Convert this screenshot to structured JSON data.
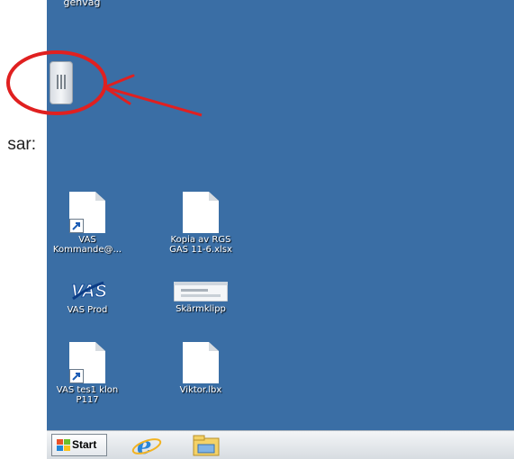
{
  "left_text": "sar:",
  "desktop": {
    "top_caption": "genväg",
    "icons": [
      {
        "label_line1": "VAS",
        "label_line2": "Kommande@...",
        "icon": "document-shortcut-icon"
      },
      {
        "label_line1": "Kopia av RGS",
        "label_line2": "GAS 11-6.xlsx",
        "icon": "document-icon"
      },
      {
        "label_line1": "VAS Prod",
        "label_line2": "",
        "icon": "vas-logo-icon"
      },
      {
        "label_line1": "Skärmklipp",
        "label_line2": "",
        "icon": "screenshot-thumbnail-icon"
      },
      {
        "label_line1": "VAS tes1 klon",
        "label_line2": "P117",
        "icon": "document-shortcut-icon"
      },
      {
        "label_line1": "Viktor.lbx",
        "label_line2": "",
        "icon": "document-icon"
      }
    ]
  },
  "taskbar": {
    "start_label": "Start",
    "pinned": [
      "internet-explorer-icon",
      "file-explorer-icon"
    ]
  },
  "colors": {
    "desktop": "#3a6ea5",
    "annotation": "#e02020"
  }
}
